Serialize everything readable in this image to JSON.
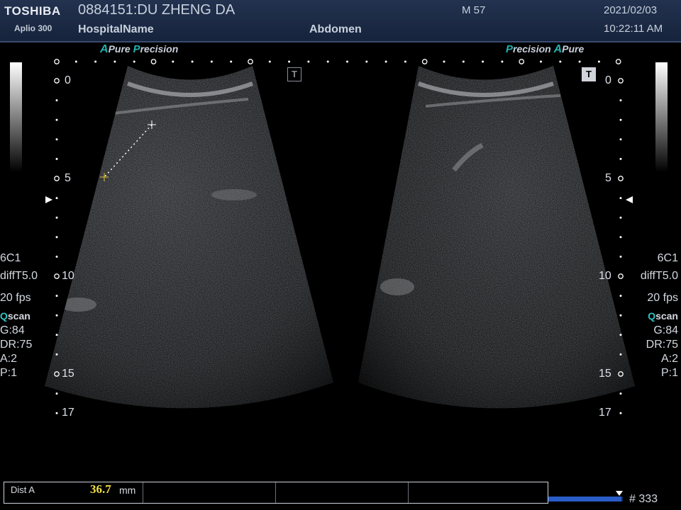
{
  "header": {
    "brand": "TOSHIBA",
    "model": "Aplio 300",
    "patient": "0884151:DU ZHENG DA",
    "hospital": "HospitalName",
    "age_sex": "M 57",
    "exam": "Abdomen",
    "date": "2021/02/03",
    "time": "10:22:11 AM"
  },
  "logos": {
    "left": {
      "a": "A",
      "pure": "Pure",
      "p": "P",
      "precision": "recision"
    },
    "right": {
      "p": "P",
      "precision": "recision",
      "a": "A",
      "pure": "Pure"
    }
  },
  "depth_marks": {
    "labels": [
      "0",
      "5",
      "10",
      "15",
      "17"
    ]
  },
  "left_panel": {
    "probe": "6C1",
    "filter": "diffT5.0",
    "fps": "20 fps",
    "qscan_q": "Q",
    "qscan_rest": "scan",
    "gain": "G:84",
    "dr": "DR:75",
    "a": "A:2",
    "p": "P:1"
  },
  "right_panel": {
    "probe": "6C1",
    "filter": "diffT5.0",
    "fps": "20 fps",
    "qscan_q": "Q",
    "qscan_rest": "scan",
    "gain": "G:84",
    "dr": "DR:75",
    "a": "A:2",
    "p": "P:1"
  },
  "tmarker": {
    "left": "T",
    "right": "T"
  },
  "measurement": {
    "name": "Dist A",
    "value": "36.7",
    "unit": "mm"
  },
  "cine": {
    "frame": "# 333",
    "progress": 0.98
  },
  "icons": [
    "depth-dot-icon",
    "focus-marker-icon",
    "caliper-cross-icon",
    "t-marker-icon"
  ]
}
